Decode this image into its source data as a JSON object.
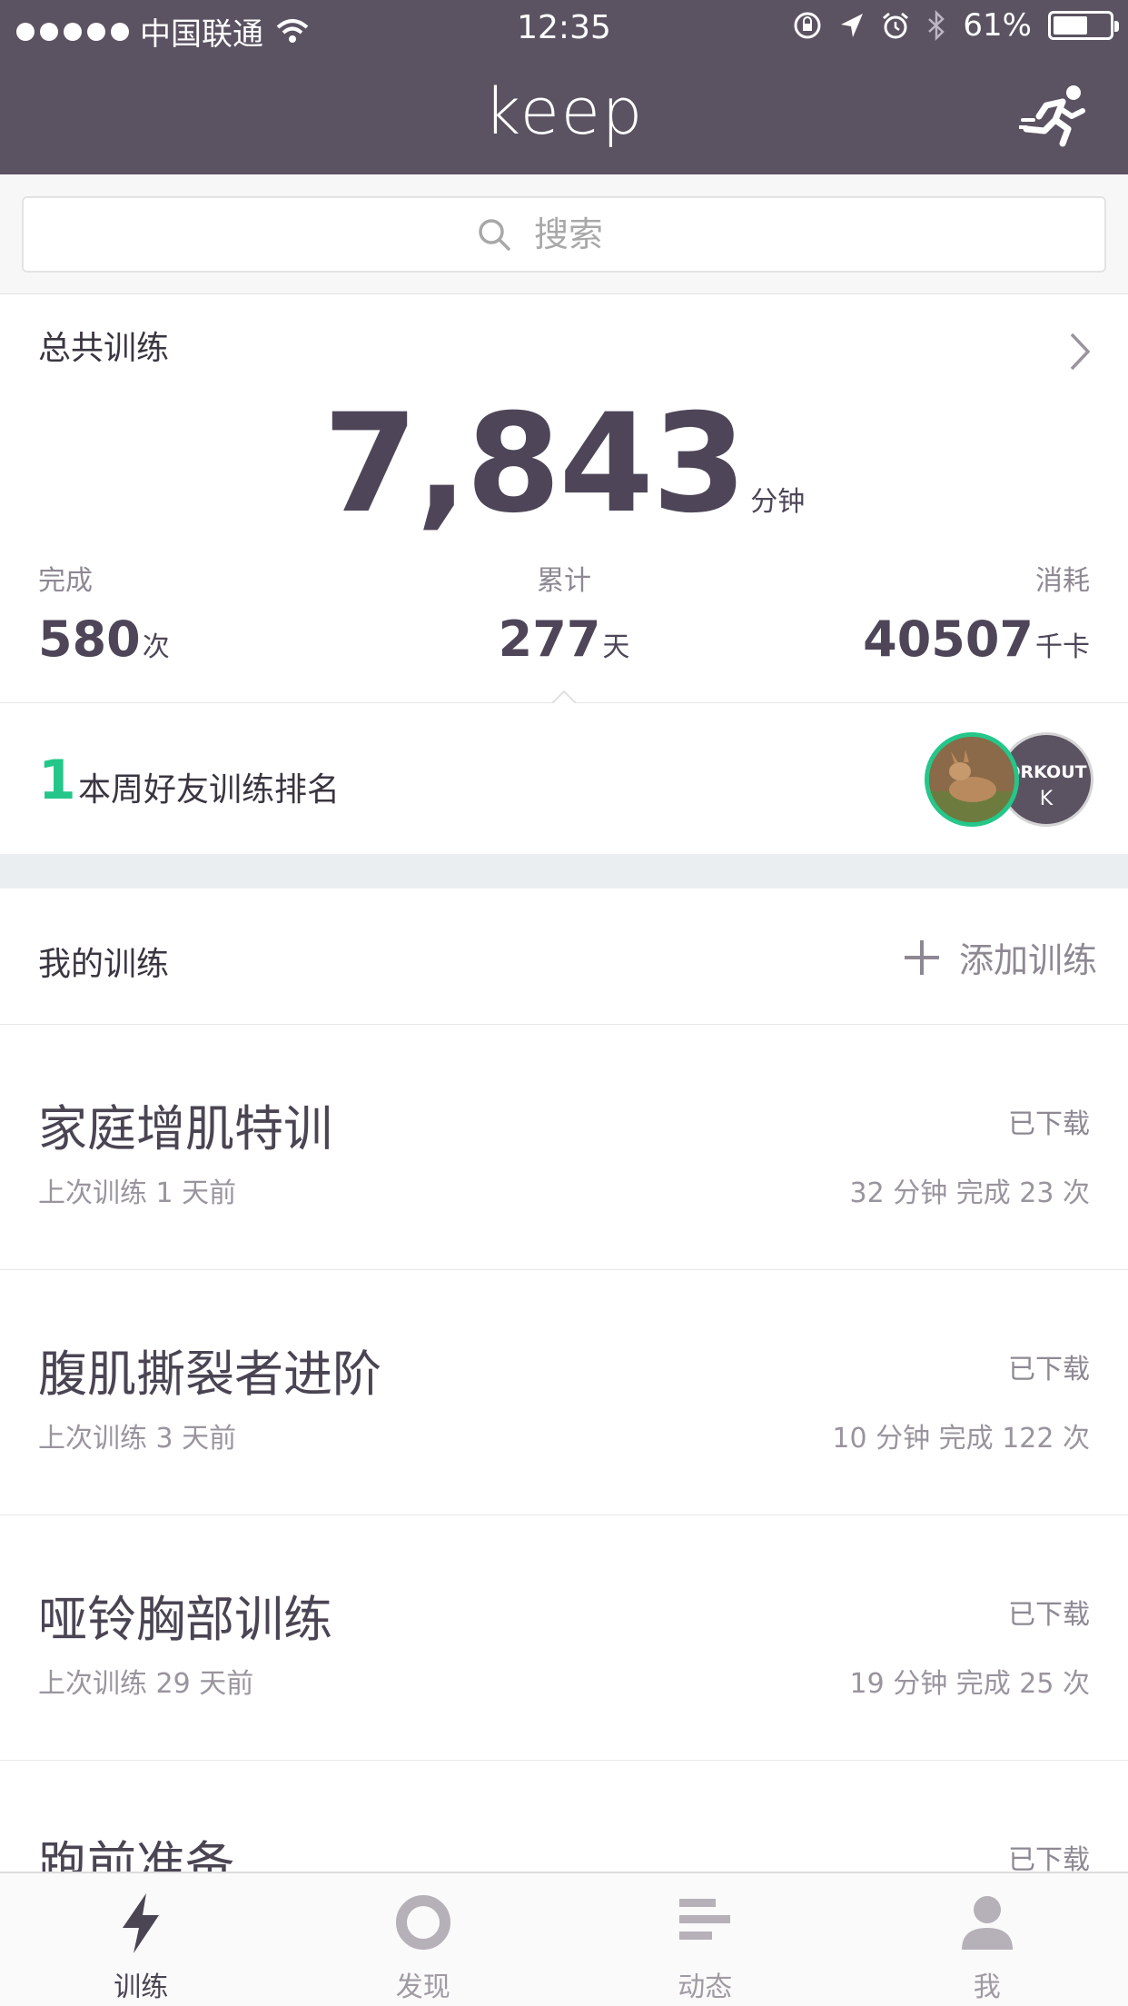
{
  "status_bar": {
    "carrier": "中国联通",
    "time": "12:35",
    "battery": "61%",
    "battery_level": 0.61
  },
  "header": {
    "logo": "keep",
    "right_icon": "runner-icon"
  },
  "search": {
    "placeholder": "搜索"
  },
  "total": {
    "title": "总共训练",
    "minutes": "7,843",
    "minutes_unit": "分钟",
    "complete_label": "完成",
    "complete_value": "580",
    "complete_unit": "次",
    "cumulative_label": "累计",
    "cumulative_value": "277",
    "cumulative_unit": "天",
    "calories_label": "消耗",
    "calories_value": "40507",
    "calories_unit": "千卡"
  },
  "ranking": {
    "rank": "1",
    "text": "本周好友训练排名",
    "badge_text": "ORKOUT",
    "badge_mark": "K"
  },
  "my_training": {
    "title": "我的训练",
    "add_label": "添加训练"
  },
  "courses": [
    {
      "name": "家庭增肌特训",
      "status": "已下载",
      "last": "上次训练 1 天前",
      "stats": "32 分钟 完成 23 次"
    },
    {
      "name": "腹肌撕裂者进阶",
      "status": "已下载",
      "last": "上次训练 3 天前",
      "stats": "10 分钟 完成 122 次"
    },
    {
      "name": "哑铃胸部训练",
      "status": "已下载",
      "last": "上次训练 29 天前",
      "stats": "19 分钟 完成 25 次"
    },
    {
      "name": "跑前准备",
      "status": "已下载",
      "last": "",
      "stats": ""
    }
  ],
  "tabs": [
    {
      "label": "训练",
      "icon": "lightning-icon",
      "active": true
    },
    {
      "label": "发现",
      "icon": "ring-icon",
      "active": false
    },
    {
      "label": "动态",
      "icon": "feed-lines-icon",
      "active": false
    },
    {
      "label": "我",
      "icon": "person-icon",
      "active": false
    }
  ],
  "colors": {
    "header_bg": "#5b5262",
    "accent_green": "#24c789",
    "text_dark": "#4a4453",
    "text_gray": "#9a949e"
  }
}
